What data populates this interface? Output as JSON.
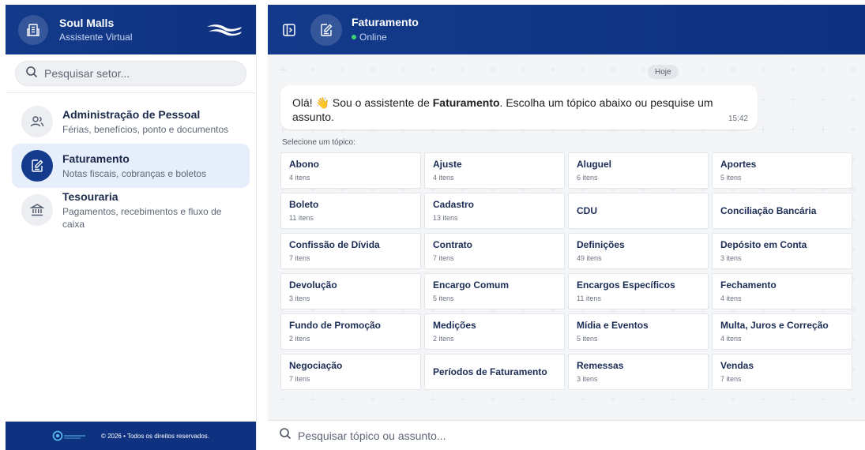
{
  "sidebar": {
    "title": "Soul Malls",
    "subtitle": "Assistente Virtual",
    "search_placeholder": "Pesquisar setor...",
    "items": [
      {
        "name": "Administração de Pessoal",
        "desc": "Férias, benefícios, ponto e documentos",
        "icon": "users-icon",
        "active": false
      },
      {
        "name": "Faturamento",
        "desc": "Notas fiscais, cobranças e boletos",
        "icon": "edit-document-icon",
        "active": true
      },
      {
        "name": "Tesouraria",
        "desc": "Pagamentos, recebimentos e fluxo de caixa",
        "icon": "bank-icon",
        "active": false
      }
    ],
    "footer_text": "© 2026 • Todos os direitos reservados."
  },
  "chat_header": {
    "title": "Faturamento",
    "status": "Online"
  },
  "chat": {
    "day_badge": "Hoje",
    "message_prefix": "Olá! 👋 Sou o assistente de ",
    "message_bold": "Faturamento",
    "message_suffix": ". Escolha um tópico abaixo ou pesquise um assunto.",
    "message_time": "15:42",
    "select_label": "Selecione um tópico:",
    "search_placeholder": "Pesquisar tópico ou assunto..."
  },
  "topics": [
    {
      "name": "Abono",
      "count": "4 itens"
    },
    {
      "name": "Ajuste",
      "count": "4 itens"
    },
    {
      "name": "Aluguel",
      "count": "6 itens"
    },
    {
      "name": "Aportes",
      "count": "5 itens"
    },
    {
      "name": "Boleto",
      "count": "11 itens"
    },
    {
      "name": "Cadastro",
      "count": "13 itens"
    },
    {
      "name": "CDU",
      "count": ""
    },
    {
      "name": "Conciliação Bancária",
      "count": ""
    },
    {
      "name": "Confissão de Dívida",
      "count": "7 itens"
    },
    {
      "name": "Contrato",
      "count": "7 itens"
    },
    {
      "name": "Definições",
      "count": "49 itens"
    },
    {
      "name": "Depósito em Conta",
      "count": "3 itens"
    },
    {
      "name": "Devolução",
      "count": "3 itens"
    },
    {
      "name": "Encargo Comum",
      "count": "5 itens"
    },
    {
      "name": "Encargos Específicos",
      "count": "11 itens"
    },
    {
      "name": "Fechamento",
      "count": "4 itens"
    },
    {
      "name": "Fundo de Promoção",
      "count": "2 itens"
    },
    {
      "name": "Medições",
      "count": "2 itens"
    },
    {
      "name": "Mídia e Eventos",
      "count": "5 itens"
    },
    {
      "name": "Multa, Juros e Correção",
      "count": "4 itens"
    },
    {
      "name": "Negociação",
      "count": "7 itens"
    },
    {
      "name": "Períodos de Faturamento",
      "count": ""
    },
    {
      "name": "Remessas",
      "count": "3 itens"
    },
    {
      "name": "Vendas",
      "count": "7 itens"
    }
  ],
  "colors": {
    "primary": "#0f3280",
    "active_bg": "#e6eefb",
    "online": "#3fd27a"
  }
}
